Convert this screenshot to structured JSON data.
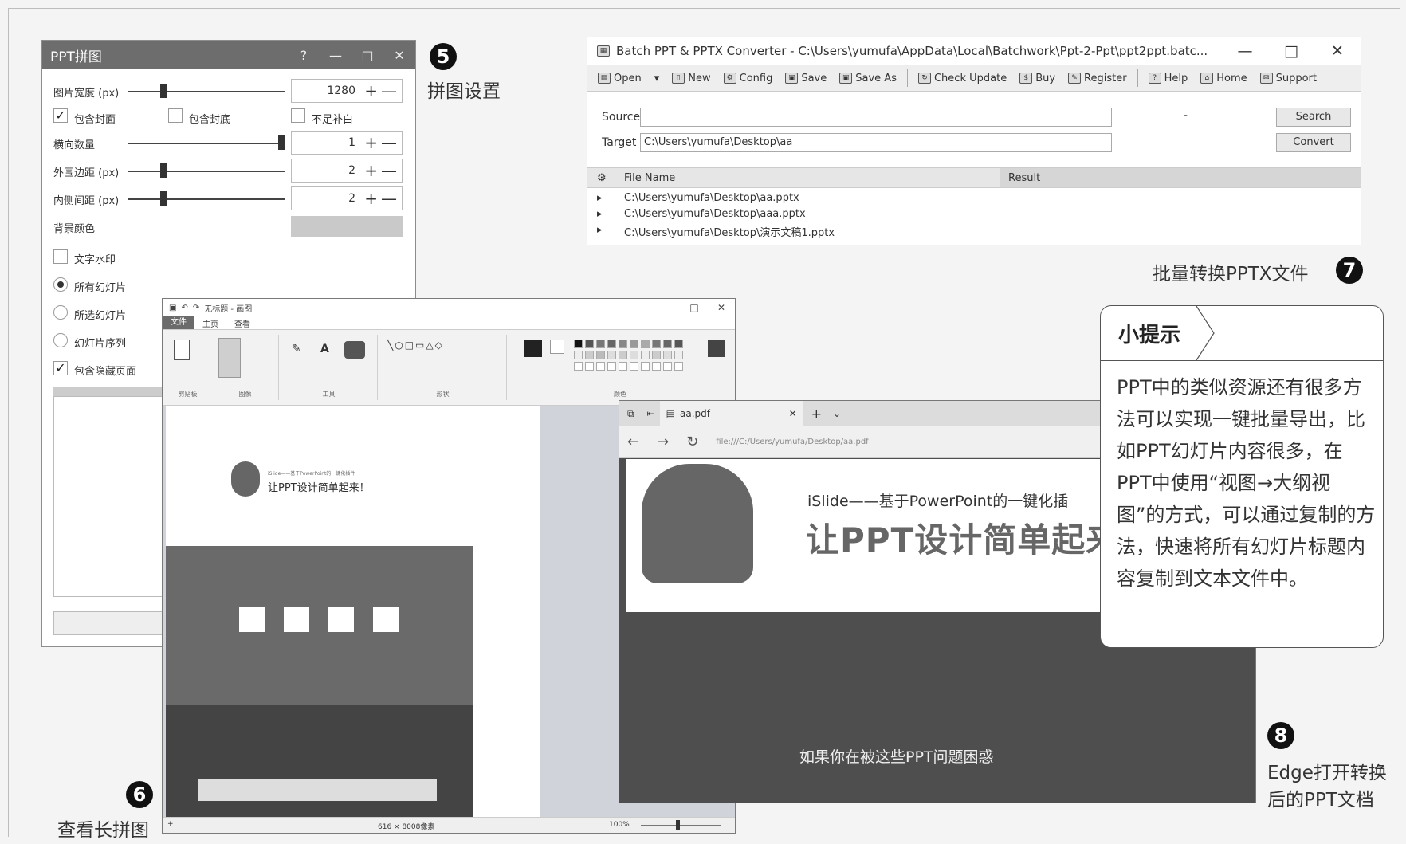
{
  "captions": {
    "c5": "拼图设置",
    "c6": "查看长拼图",
    "c7": "批量转换PPTX文件",
    "c8_line1": "Edge打开转换",
    "c8_line2": "后的PPT文档"
  },
  "numbers": {
    "n5": "5",
    "n6": "6",
    "n7": "7",
    "n8": "8"
  },
  "pintu": {
    "title": "PPT拼图",
    "title_buttons": [
      "?",
      "—",
      "□",
      "✕"
    ],
    "width_label": "图片宽度 (px)",
    "width_value": "1280",
    "include_cover": "包含封面",
    "include_back": "包含封底",
    "fill_blank": "不足补白",
    "h_count_label": "横向数量",
    "h_count_value": "1",
    "outer_margin_label": "外围边距 (px)",
    "outer_margin_value": "2",
    "inner_margin_label": "内侧间距 (px)",
    "inner_margin_value": "2",
    "bg_color_label": "背景颜色",
    "watermark": "文字水印",
    "all_slides": "所有幻灯片",
    "selected_slides": "所选幻灯片",
    "slide_sequence": "幻灯片序列",
    "include_hidden": "包含隐藏页面",
    "plus": "+",
    "minus": "—",
    "check": "✓"
  },
  "converter": {
    "title": "Batch PPT & PPTX Converter - C:\\Users\\yumufa\\AppData\\Local\\Batchwork\\Ppt-2-Ppt\\ppt2ppt.batc...",
    "ctl_min": "—",
    "ctl_max": "□",
    "ctl_close": "✕",
    "toolbar": [
      "Open",
      "▾",
      "New",
      "Config",
      "Save",
      "Save As",
      "Check Update",
      "Buy",
      "Register",
      "Help",
      "Home",
      "Support"
    ],
    "source_label": "Source",
    "target_label": "Target",
    "source_value": "",
    "target_value": "C:\\Users\\yumufa\\Desktop\\aa",
    "dash": "-",
    "search_btn": "Search",
    "convert_btn": "Convert",
    "col_file": "File Name",
    "col_result": "Result",
    "files": [
      "C:\\Users\\yumufa\\Desktop\\aa.pptx",
      "C:\\Users\\yumufa\\Desktop\\aaa.pptx",
      "C:\\Users\\yumufa\\Desktop\\演示文稿1.pptx"
    ]
  },
  "paint": {
    "title": "无标题 - 画图",
    "menu": [
      "文件",
      "主页",
      "查看"
    ],
    "groups": [
      "剪贴板",
      "图像",
      "工具",
      "形状",
      "颜色"
    ],
    "slide_caption": "让PPT设计简单起来！",
    "slide_small": "iSlide——基于PowerPoint的一键化插件",
    "status_size": "616 × 8008像素",
    "status_zoom": "100%"
  },
  "edge": {
    "tab_title": "aa.pdf",
    "url": "file:///C:/Users/yumufa/Desktop/aa.pdf",
    "subtitle": "iSlide——基于PowerPoint的一键化插",
    "headline": "让PPT设计简单起来",
    "bottom_text": "如果你在被这些PPT问题困惑"
  },
  "tip": {
    "heading": "小提示",
    "body": "PPT中的类似资源还有很多方法可以实现一键批量导出，比如PPT幻灯片内容很多，在PPT中使用“视图→大纲视图”的方式，可以通过复制的方法，快速将所有幻灯片标题内容复制到文本文件中。"
  },
  "colors": {
    "accent_dark": "#111111",
    "titlebar_gray": "#6d6d6d"
  }
}
